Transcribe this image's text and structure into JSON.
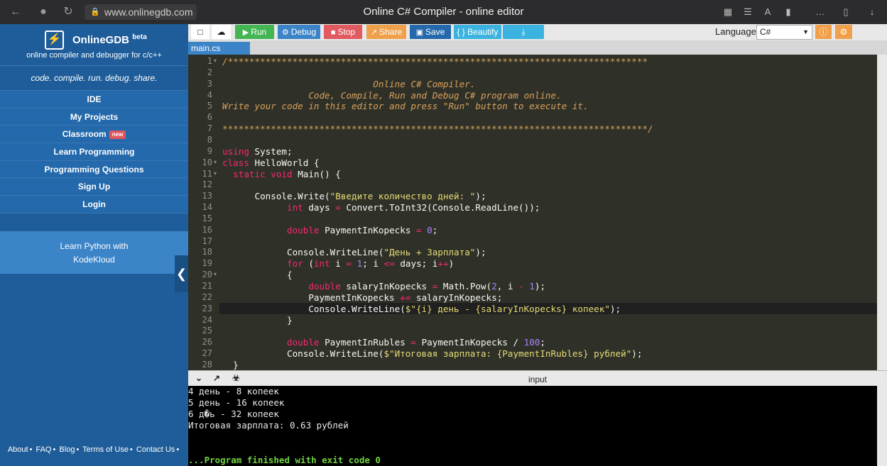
{
  "browser": {
    "url": "www.onlinegdb.com",
    "title": "Online C# Compiler - online editor"
  },
  "sidebar": {
    "brand_name": "OnlineGDB",
    "brand_sup": "beta",
    "brand_sub": "online compiler and debugger for c/c++",
    "slogan": "code. compile. run. debug. share.",
    "items": [
      {
        "label": "IDE"
      },
      {
        "label": "My Projects"
      },
      {
        "label": "Classroom",
        "badge": "new"
      },
      {
        "label": "Learn Programming"
      },
      {
        "label": "Programming Questions"
      },
      {
        "label": "Sign Up"
      },
      {
        "label": "Login"
      }
    ],
    "promo_line1": "Learn Python with",
    "promo_line2": "KodeKloud",
    "footer": [
      "About",
      "FAQ",
      "Blog",
      "Terms of Use",
      "Contact Us"
    ]
  },
  "toolbar": {
    "run": "Run",
    "debug": "Debug",
    "stop": "Stop",
    "share": "Share",
    "save": "Save",
    "beautify": "{ } Beautify",
    "language_label": "Language",
    "language_value": "C#"
  },
  "colors": {
    "run": "#44b553",
    "debug": "#3b84c8",
    "stop": "#e05a60",
    "share": "#f0a04a",
    "save": "#2369ab",
    "beautify": "#3bb3e0",
    "download": "#3bb3e0"
  },
  "tab": {
    "name": "main.cs"
  },
  "editor": {
    "lines": [
      "/******************************************************************************",
      "",
      "                            Online C# Compiler.",
      "                Code, Compile, Run and Debug C# program online.",
      "Write your code in this editor and press \"Run\" button to execute it.",
      "",
      "*******************************************************************************/",
      "",
      "using System;",
      "class HelloWorld {",
      "  static void Main() {",
      "",
      "      Console.Write(\"Введите количество дней: \");",
      "            int days = Convert.ToInt32(Console.ReadLine());",
      "",
      "            double PaymentInKopecks = 0;",
      "",
      "            Console.WriteLine(\"День + Зарплата\");",
      "            for (int i = 1; i <= days; i++)",
      "            {",
      "                double salaryInKopecks = Math.Pow(2, i - 1);",
      "                PaymentInKopecks += salaryInKopecks;",
      "                Console.WriteLine($\"{i} день - {salaryInKopecks} копеек\");",
      "            }",
      "",
      "            double PaymentInRubles = PaymentInKopecks / 100;",
      "            Console.WriteLine($\"Итоговая зарплата: {PaymentInRubles} рублей\");",
      "  }"
    ]
  },
  "input_bar": {
    "label": "input"
  },
  "console": {
    "lines": [
      "4 день - 8 копеек",
      "5 день - 16 копеек",
      "6 д�ь - 32 копеек",
      "Итоговая зарплата: 0.63 рублей"
    ],
    "finished": "...Program finished with exit code 0"
  }
}
